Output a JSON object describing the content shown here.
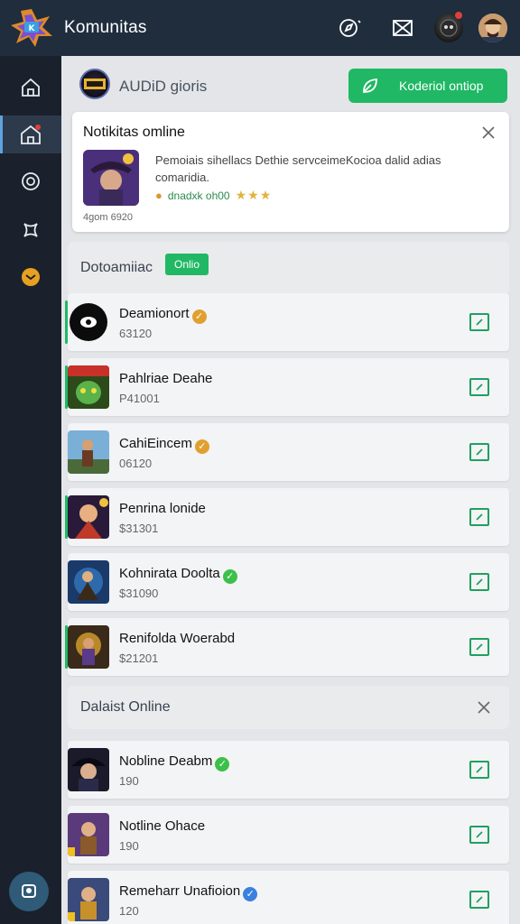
{
  "app": {
    "title": "Komunitas"
  },
  "topbar": {
    "icons": [
      "compass-icon",
      "inbox-icon",
      "game-avatar",
      "user-avatar"
    ]
  },
  "sidebar": {
    "items": [
      {
        "icon": "home-icon",
        "active": false
      },
      {
        "icon": "home-alt-icon",
        "active": true,
        "badge": true
      },
      {
        "icon": "target-icon",
        "active": false
      },
      {
        "icon": "puzzle-icon",
        "active": false
      },
      {
        "icon": "chat-icon",
        "active": false
      }
    ]
  },
  "header": {
    "title": "AUDiD gioris",
    "cta_label": "Koderiol ontiop"
  },
  "notification": {
    "title": "Notikitas omline",
    "text": "Pemoiais sihellacs Dethie servceimeKocioa dalid adias comaridia.",
    "meta": "dnadxk oh00",
    "rating": "★★★",
    "time": "4gom 6920"
  },
  "sections": [
    {
      "title": "Dotoamiiac",
      "badge": "Onlio",
      "rows": [
        {
          "name": "Deamionort",
          "sub": "63120",
          "verified": "gold",
          "online": true
        },
        {
          "name": "Pahlriae Deahe",
          "sub": "P41001",
          "verified": "",
          "online": true
        },
        {
          "name": "CahiEincem",
          "sub": "06120",
          "verified": "gold",
          "online": false
        },
        {
          "name": "Penrina lonide",
          "sub": "$31301",
          "verified": "",
          "online": true
        },
        {
          "name": "Kohnirata Doolta",
          "sub": "$31090",
          "verified": "green",
          "online": false
        },
        {
          "name": "Renifolda Woerabd",
          "sub": "$21201",
          "verified": "",
          "online": true
        }
      ]
    },
    {
      "title": "Dalaist Online",
      "rows": [
        {
          "name": "Nobline Deabm",
          "sub": "190",
          "verified": "green",
          "online": false
        },
        {
          "name": "Notline Ohace",
          "sub": "190",
          "verified": "",
          "online": false
        },
        {
          "name": "Remeharr Unafioion",
          "sub": "120",
          "verified": "blue",
          "online": false
        }
      ]
    }
  ],
  "colors": {
    "topbar": "#1f2d3d",
    "sidebar": "#1a212c",
    "accent_green": "#20b865",
    "background": "#e3e5e8"
  }
}
